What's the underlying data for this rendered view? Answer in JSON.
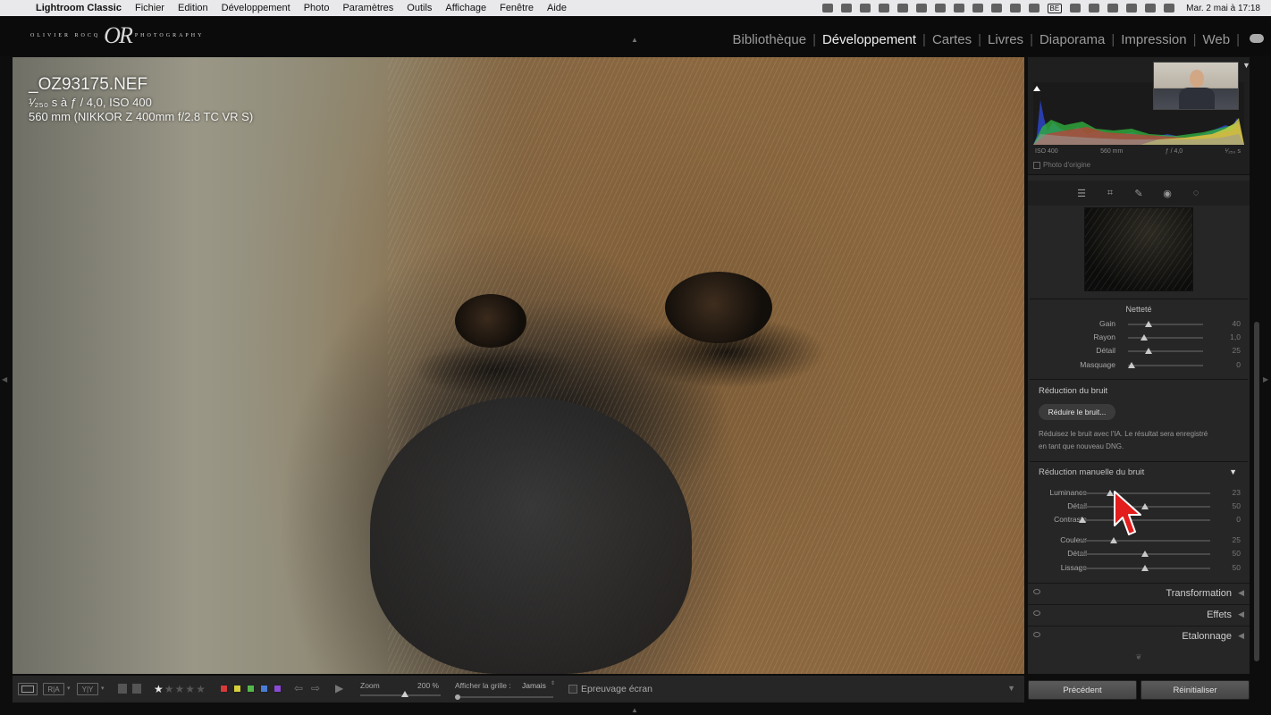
{
  "menubar": {
    "app": "Lightroom Classic",
    "items": [
      "Fichier",
      "Edition",
      "Développement",
      "Photo",
      "Paramètres",
      "Outils",
      "Affichage",
      "Fenêtre",
      "Aide"
    ],
    "status_icons": [
      "vpn-icon",
      "sync-icon",
      "dropbox-icon",
      "camera-icon",
      "screen-icon",
      "list-icon",
      "history-icon",
      "shapes-icon",
      "image-icon",
      "monitor-icon",
      "volume-icon",
      "airplay-icon"
    ],
    "keyboard": "BE",
    "clock": "Mar. 2 mai à 17:18"
  },
  "topbar": {
    "logo_small_left": "OLIVIER ROCQ",
    "logo_letters": "OR",
    "logo_small_right": "PHOTOGRAPHY",
    "modules": [
      "Bibliothèque",
      "Développement",
      "Cartes",
      "Livres",
      "Diaporama",
      "Impression",
      "Web"
    ],
    "active_module": "Développement"
  },
  "image_info": {
    "filename": "_OZ93175.NEF",
    "exposure": "¹⁄₂₅₀ s à ƒ / 4,0, ISO 400",
    "lens": "560 mm (NIKKOR Z 400mm f/2.8 TC VR S)"
  },
  "histogram": {
    "iso": "ISO 400",
    "focal": "560 mm",
    "aperture": "ƒ / 4,0",
    "shutter": "¹⁄₂₅₀ s",
    "original_photo": "Photo d'origine"
  },
  "tools": [
    "sliders-icon",
    "crop-icon",
    "heal-icon",
    "redeye-icon",
    "masking-icon"
  ],
  "sharpening": {
    "title": "Netteté",
    "sliders": [
      {
        "label": "Gain",
        "value": "40",
        "pos": 0.27
      },
      {
        "label": "Rayon",
        "value": "1,0",
        "pos": 0.22
      },
      {
        "label": "Détail",
        "value": "25",
        "pos": 0.27
      },
      {
        "label": "Masquage",
        "value": "0",
        "pos": 0.05
      }
    ]
  },
  "noise_reduction": {
    "title": "Réduction du bruit",
    "button": "Réduire le bruit...",
    "description": "Réduisez le bruit avec l'IA. Le résultat sera enregistré en tant que nouveau DNG.",
    "manual_title": "Réduction manuelle du bruit",
    "sliders_luminance": [
      {
        "label": "Luminance",
        "value": "23",
        "pos": 0.23
      },
      {
        "label": "Détail",
        "value": "50",
        "pos": 0.5
      },
      {
        "label": "Contraste",
        "value": "0",
        "pos": 0.02
      }
    ],
    "sliders_color": [
      {
        "label": "Couleur",
        "value": "25",
        "pos": 0.26
      },
      {
        "label": "Détail",
        "value": "50",
        "pos": 0.5
      },
      {
        "label": "Lissage",
        "value": "50",
        "pos": 0.5
      }
    ]
  },
  "collapsed_panels": [
    "Transformation",
    "Effets",
    "Etalonnage"
  ],
  "bottom_buttons": {
    "previous": "Précédent",
    "reset": "Réinitialiser"
  },
  "toolbar": {
    "view_loupe": "",
    "view_before_after_1": "R|A",
    "view_before_after_2": "Y|Y",
    "rating": 1,
    "rating_max": 5,
    "color_labels": [
      "#d63b3b",
      "#d6cf3b",
      "#54b94a",
      "#4a7dd6",
      "#8a4ad6"
    ],
    "zoom_label": "Zoom",
    "zoom_value": "200 %",
    "zoom_level": 0.55,
    "grid_label": "Afficher la grille :",
    "grid_value": "Jamais",
    "proof_label": "Epreuvage écran"
  }
}
